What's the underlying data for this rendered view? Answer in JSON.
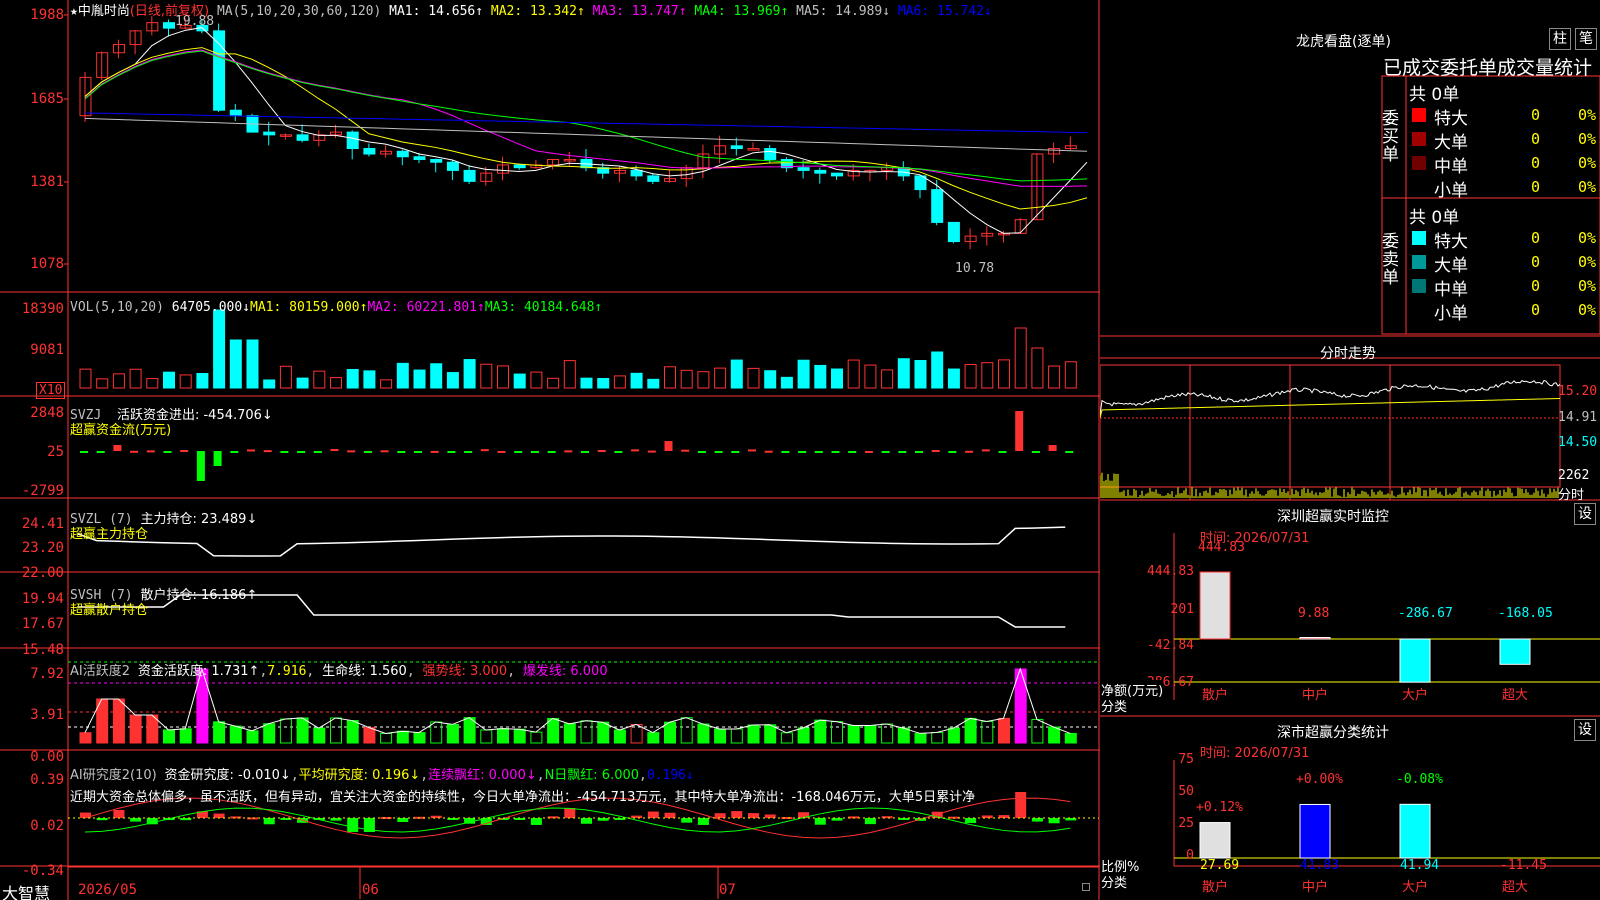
{
  "header": {
    "star": "★",
    "stock": "中胤时尚",
    "period": "(日线,前复权)",
    "ma_params": "MA(5,10,20,30,60,120)",
    "ma1": "MA1: 14.656↑",
    "ma2": "MA2: 13.342↑",
    "ma3": "MA3: 13.747↑",
    "ma4": "MA4: 13.969↑",
    "ma5": "MA5: 14.989↓",
    "ma6": "MA6: 15.742↓",
    "hi_label": "19.88",
    "lo_label": "10.78"
  },
  "price_axis": [
    "1988",
    "1685",
    "1381",
    "1078"
  ],
  "vol": {
    "title": "VOL(5,10,20)",
    "value": "64705.000↓",
    "ma1": "MA1: 80159.000↑",
    "ma2": "MA2: 60221.801↑",
    "ma3": "MA3: 40184.648↑",
    "axis": [
      "18390",
      "9081"
    ],
    "unit": "X10"
  },
  "svzj": {
    "title": "SVZJ",
    "name": "活跃资金进出: -454.706↓",
    "sub": "超赢资金流(万元)",
    "axis": [
      "2848",
      "25",
      "-2799"
    ]
  },
  "svzl": {
    "title": "SVZL (7)",
    "name": "主力持仓: 23.489↓",
    "sub": "超赢主力持仓",
    "axis": [
      "24.41",
      "23.20",
      "22.00"
    ]
  },
  "svsh": {
    "title": "SVSH (7)",
    "name": "散户持仓: 16.186↑",
    "sub": "超赢散户持仓",
    "axis": [
      "19.94",
      "17.67",
      "15.48"
    ]
  },
  "ai1": {
    "title": "AI活跃度2",
    "a": "资金活跃度: 1.731↑",
    "b": "7.916",
    "c": "生命线: 1.560",
    "d": "强势线: 3.000",
    "e": "爆发线: 6.000",
    "axis": [
      "7.92",
      "3.91",
      "0.00"
    ]
  },
  "ai2": {
    "title": "AI研究度2(10)",
    "a": "资金研究度: -0.010↓",
    "b": "平均研究度: 0.196↓",
    "c": "连续飘红: 0.000↓",
    "d": "N日飘红: 6.000",
    "e": "0.196↓",
    "axis": [
      "0.39",
      "0.02",
      "-0.34"
    ],
    "text": "近期大资金总体偏多，虽不活跃，但有异动，宜关注大资金的持续性，今日大单净流出：-454.713万元，其中特大单净流出：-168.046万元，大单5日累计净"
  },
  "bottom": {
    "logo": "大智慧",
    "dates": [
      "2026/05",
      "06",
      "07"
    ]
  },
  "lhb": {
    "title": "龙虎看盘(逐单)",
    "btn1": "柱",
    "btn2": "笔",
    "sub": "已成交委托单成交量统计",
    "buy_label": "委买单",
    "sell_label": "委卖单",
    "buy_total": "共 0单",
    "sell_total": "共 0单",
    "buy_rows": [
      {
        "name": "特大",
        "v": "0",
        "p": "0%",
        "color": "#ff0000"
      },
      {
        "name": "大单",
        "v": "0",
        "p": "0%",
        "color": "#a00000"
      },
      {
        "name": "中单",
        "v": "0",
        "p": "0%",
        "color": "#700000"
      },
      {
        "name": "小单",
        "v": "0",
        "p": "0%",
        "color": ""
      }
    ],
    "sell_rows": [
      {
        "name": "特大",
        "v": "0",
        "p": "0%",
        "color": "#00ffff"
      },
      {
        "name": "大单",
        "v": "0",
        "p": "0%",
        "color": "#009999"
      },
      {
        "name": "中单",
        "v": "0",
        "p": "0%",
        "color": "#007777"
      },
      {
        "name": "小单",
        "v": "0",
        "p": "0%",
        "color": ""
      }
    ]
  },
  "fs": {
    "title": "分时走势",
    "axis": [
      "15.20",
      "14.91",
      "14.50"
    ],
    "vol_axis": "2262",
    "unit": "分时"
  },
  "monitor": {
    "title": "深圳超赢实时监控",
    "set": "设",
    "time": "时间: 2026/07/31",
    "axis": [
      "444.83",
      "201",
      "-42.84",
      "-286.67"
    ],
    "ylabel": "净额(万元)",
    "xlabel": "分类",
    "cats": [
      "散户",
      "中户",
      "大户",
      "超大"
    ],
    "values": [
      "444.83",
      "9.88",
      "-286.67",
      "-168.05"
    ],
    "nums": [
      444.83,
      9.88,
      -286.67,
      -168.05
    ]
  },
  "stat": {
    "title": "深市超赢分类统计",
    "set": "设",
    "time": "时间: 2026/07/31",
    "axis": [
      "75",
      "50",
      "25",
      "0"
    ],
    "ylabel": "比例%",
    "xlabel": "分类",
    "cats": [
      "散户",
      "中户",
      "大户",
      "超大"
    ],
    "tops": [
      "+0.12%",
      "+0.00%",
      "-0.08%",
      ""
    ],
    "values": [
      "27.69",
      "41.83",
      "41.94",
      "-11.45"
    ],
    "nums": [
      27.69,
      41.83,
      41.94,
      0
    ]
  },
  "colors": {
    "red": "#ff3232",
    "cyan": "#00ffff",
    "green": "#00ff00",
    "yellow": "#ffff00",
    "magenta": "#ff00ff",
    "blue": "#0000ff"
  }
}
